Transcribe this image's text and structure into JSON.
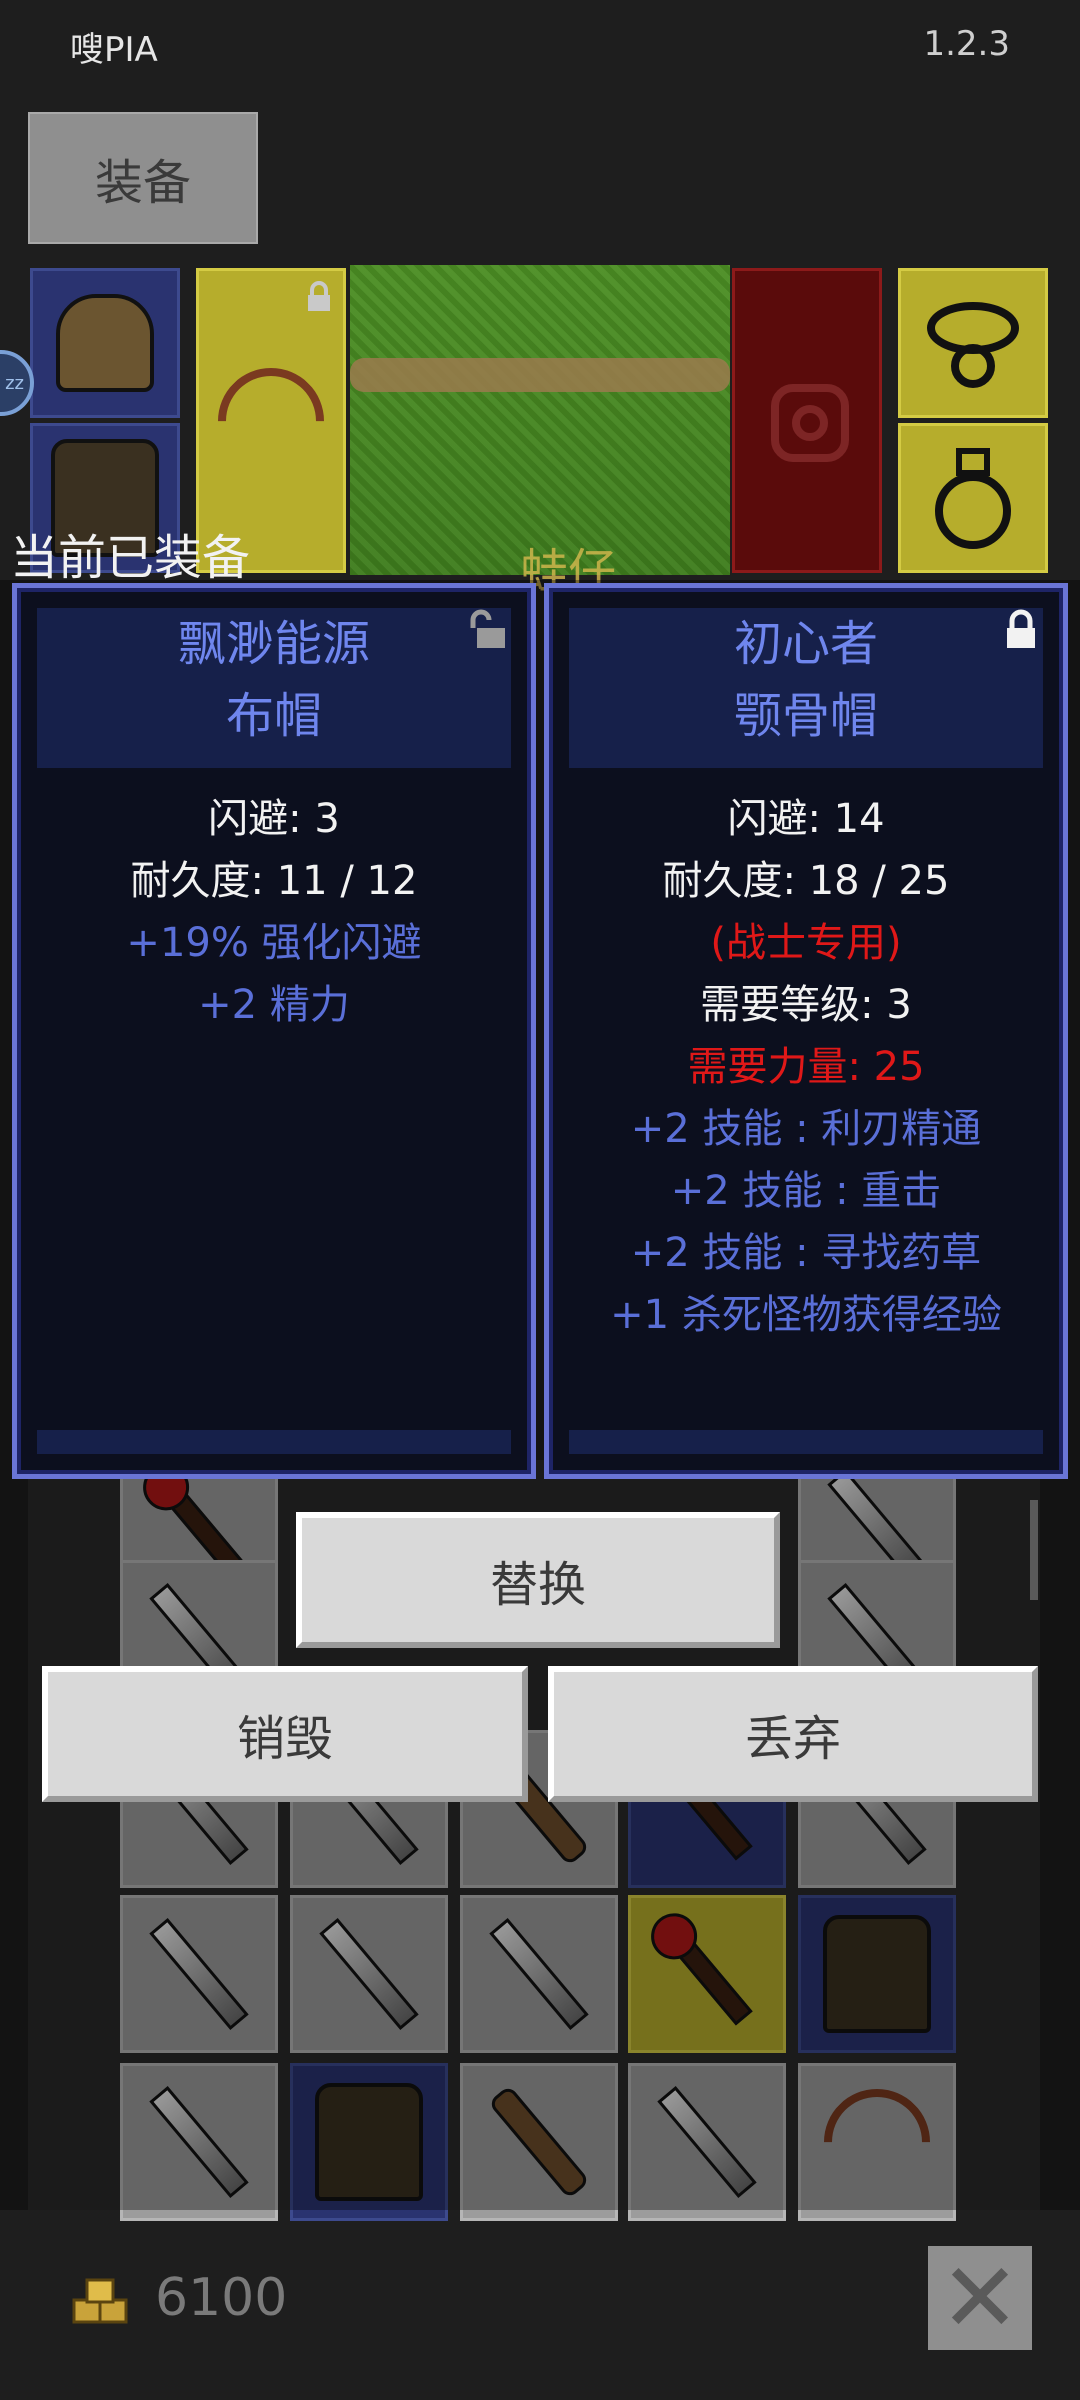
{
  "status_bar": {
    "app_name": "嗖PIA",
    "version": "1.2.3"
  },
  "tabs": {
    "equipment_label": "装备"
  },
  "scene": {
    "character_name": "蛙仔",
    "zz_badge": "zz"
  },
  "current_equipped_label": "当前已装备",
  "equipped_card": {
    "name_line1": "飘渺能源",
    "name_line2": "布帽",
    "stats": [
      {
        "text": "闪避: 3",
        "color": "white"
      },
      {
        "text": "耐久度: 11 / 12",
        "color": "white"
      },
      {
        "text": "+19% 强化闪避",
        "color": "blue"
      },
      {
        "text": "+2 精力",
        "color": "blue"
      }
    ],
    "lock_icon": "unlocked-icon"
  },
  "new_card": {
    "name_line1": "初心者",
    "name_line2": "颚骨帽",
    "stats": [
      {
        "text": "闪避: 14",
        "color": "white"
      },
      {
        "text": "耐久度: 18 / 25",
        "color": "white"
      },
      {
        "text": "(战士专用)",
        "color": "red"
      },
      {
        "text": "需要等级: 3",
        "color": "white"
      },
      {
        "text": "需要力量: 25",
        "color": "red"
      },
      {
        "text": "+2 技能 : 利刃精通",
        "color": "blue"
      },
      {
        "text": "+2 技能 : 重击",
        "color": "blue"
      },
      {
        "text": "+2 技能 : 寻找药草",
        "color": "blue"
      },
      {
        "text": "+1 杀死怪物获得经验",
        "color": "blue"
      }
    ],
    "lock_icon": "locked-icon"
  },
  "actions": {
    "replace_label": "替换",
    "destroy_label": "销毁",
    "discard_label": "丢弃"
  },
  "footer": {
    "gold_amount": "6100",
    "gold_icon": "gold-coins-icon",
    "close_icon": "close-icon"
  },
  "colors": {
    "white": "#f2f2f2",
    "blue": "#5a6fd8",
    "red": "#e01818",
    "card_border": "#6a75d6"
  }
}
